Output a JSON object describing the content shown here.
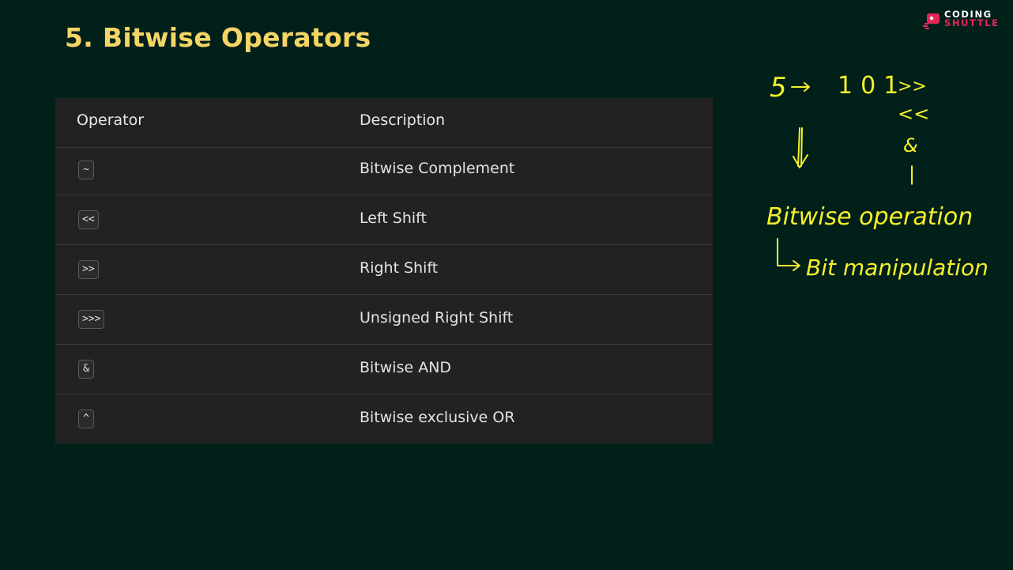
{
  "slide": {
    "title": "5. Bitwise Operators"
  },
  "logo": {
    "line1": "CODING",
    "line2": "SHUTTLE"
  },
  "table": {
    "headers": {
      "operator": "Operator",
      "description": "Description"
    },
    "rows": [
      {
        "operator": "~",
        "description": "Bitwise Complement"
      },
      {
        "operator": "<<",
        "description": "Left Shift"
      },
      {
        "operator": ">>",
        "description": "Right Shift"
      },
      {
        "operator": ">>>",
        "description": "Unsigned Right Shift"
      },
      {
        "operator": "&",
        "description": "Bitwise AND"
      },
      {
        "operator": "^",
        "description": "Bitwise exclusive OR"
      }
    ]
  },
  "annotation": {
    "line1_num": "5",
    "line1_bits": "101",
    "ops": [
      ">>",
      "<<",
      "&",
      "|"
    ],
    "line2": "Bitwise operation",
    "line3": "Bit manipulation",
    "ink_color": "#f4f02a"
  },
  "colors": {
    "background": "#02201a",
    "title": "#f5d565",
    "table_bg": "#222222",
    "brand_red": "#e6265a"
  }
}
